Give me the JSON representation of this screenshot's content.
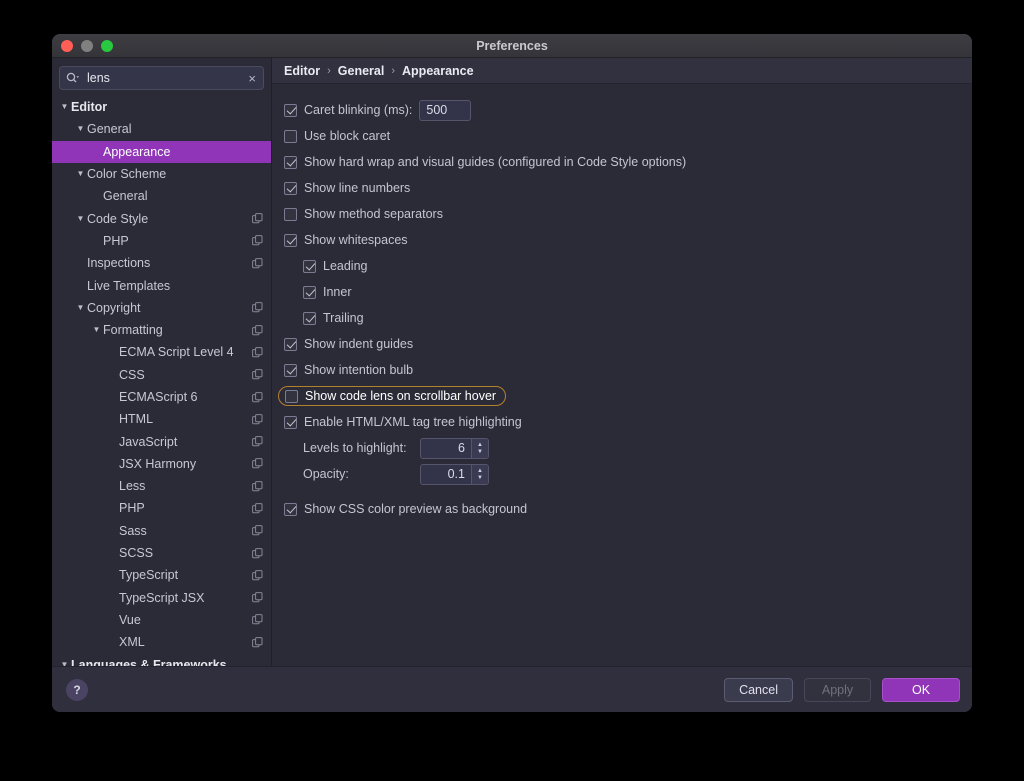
{
  "window": {
    "title": "Preferences",
    "traffic_lights": [
      "close-button",
      "minimize-button",
      "zoom-button"
    ]
  },
  "sidebar": {
    "search": {
      "value": "lens",
      "placeholder": "",
      "icon": "search-icon",
      "clear_icon": "×"
    },
    "tree": [
      {
        "label": "Editor",
        "depth": 0,
        "twisty": "▼",
        "bold": true,
        "selected": false,
        "copy": false
      },
      {
        "label": "General",
        "depth": 1,
        "twisty": "▼",
        "bold": false,
        "selected": false,
        "copy": false
      },
      {
        "label": "Appearance",
        "depth": 2,
        "twisty": "",
        "bold": false,
        "selected": true,
        "copy": false
      },
      {
        "label": "Color Scheme",
        "depth": 1,
        "twisty": "▼",
        "bold": false,
        "selected": false,
        "copy": false
      },
      {
        "label": "General",
        "depth": 2,
        "twisty": "",
        "bold": false,
        "selected": false,
        "copy": false
      },
      {
        "label": "Code Style",
        "depth": 1,
        "twisty": "▼",
        "bold": false,
        "selected": false,
        "copy": true
      },
      {
        "label": "PHP",
        "depth": 2,
        "twisty": "",
        "bold": false,
        "selected": false,
        "copy": true
      },
      {
        "label": "Inspections",
        "depth": 1,
        "twisty": "",
        "bold": false,
        "selected": false,
        "copy": true
      },
      {
        "label": "Live Templates",
        "depth": 1,
        "twisty": "",
        "bold": false,
        "selected": false,
        "copy": false
      },
      {
        "label": "Copyright",
        "depth": 1,
        "twisty": "▼",
        "bold": false,
        "selected": false,
        "copy": true
      },
      {
        "label": "Formatting",
        "depth": 2,
        "twisty": "▼",
        "bold": false,
        "selected": false,
        "copy": true
      },
      {
        "label": "ECMA Script Level 4",
        "depth": 3,
        "twisty": "",
        "bold": false,
        "selected": false,
        "copy": true
      },
      {
        "label": "CSS",
        "depth": 3,
        "twisty": "",
        "bold": false,
        "selected": false,
        "copy": true
      },
      {
        "label": "ECMAScript 6",
        "depth": 3,
        "twisty": "",
        "bold": false,
        "selected": false,
        "copy": true
      },
      {
        "label": "HTML",
        "depth": 3,
        "twisty": "",
        "bold": false,
        "selected": false,
        "copy": true
      },
      {
        "label": "JavaScript",
        "depth": 3,
        "twisty": "",
        "bold": false,
        "selected": false,
        "copy": true
      },
      {
        "label": "JSX Harmony",
        "depth": 3,
        "twisty": "",
        "bold": false,
        "selected": false,
        "copy": true
      },
      {
        "label": "Less",
        "depth": 3,
        "twisty": "",
        "bold": false,
        "selected": false,
        "copy": true
      },
      {
        "label": "PHP",
        "depth": 3,
        "twisty": "",
        "bold": false,
        "selected": false,
        "copy": true
      },
      {
        "label": "Sass",
        "depth": 3,
        "twisty": "",
        "bold": false,
        "selected": false,
        "copy": true
      },
      {
        "label": "SCSS",
        "depth": 3,
        "twisty": "",
        "bold": false,
        "selected": false,
        "copy": true
      },
      {
        "label": "TypeScript",
        "depth": 3,
        "twisty": "",
        "bold": false,
        "selected": false,
        "copy": true
      },
      {
        "label": "TypeScript JSX",
        "depth": 3,
        "twisty": "",
        "bold": false,
        "selected": false,
        "copy": true
      },
      {
        "label": "Vue",
        "depth": 3,
        "twisty": "",
        "bold": false,
        "selected": false,
        "copy": true
      },
      {
        "label": "XML",
        "depth": 3,
        "twisty": "",
        "bold": false,
        "selected": false,
        "copy": true
      },
      {
        "label": "Languages & Frameworks",
        "depth": 0,
        "twisty": "▼",
        "bold": true,
        "selected": false,
        "copy": false
      }
    ]
  },
  "breadcrumb": {
    "items": [
      "Editor",
      "General",
      "Appearance"
    ],
    "separator": "›"
  },
  "settings": {
    "caret_blinking": {
      "label": "Caret blinking (ms):",
      "checked": true,
      "value": "500"
    },
    "use_block_caret": {
      "label": "Use block caret",
      "checked": false
    },
    "show_hard_wrap": {
      "label": "Show hard wrap and visual guides (configured in Code Style options)",
      "checked": true
    },
    "show_line_numbers": {
      "label": "Show line numbers",
      "checked": true
    },
    "show_method_separators": {
      "label": "Show method separators",
      "checked": false
    },
    "show_whitespaces": {
      "label": "Show whitespaces",
      "checked": true
    },
    "whitespace_leading": {
      "label": "Leading",
      "checked": true
    },
    "whitespace_inner": {
      "label": "Inner",
      "checked": true
    },
    "whitespace_trailing": {
      "label": "Trailing",
      "checked": true
    },
    "show_indent_guides": {
      "label": "Show indent guides",
      "checked": true
    },
    "show_intention_bulb": {
      "label": "Show intention bulb",
      "checked": true
    },
    "show_code_lens": {
      "label": "Show code lens on scrollbar hover",
      "checked": false,
      "highlighted": true,
      "highlight_color": "#b5802e"
    },
    "enable_tag_tree": {
      "label": "Enable HTML/XML tag tree highlighting",
      "checked": true
    },
    "levels_to_highlight": {
      "label": "Levels to highlight:",
      "value": "6"
    },
    "opacity": {
      "label": "Opacity:",
      "value": "0.1"
    },
    "show_css_preview": {
      "label": "Show CSS color preview as background",
      "checked": true
    }
  },
  "footer": {
    "help_label": "?",
    "cancel_label": "Cancel",
    "apply_label": "Apply",
    "ok_label": "OK",
    "accent_color": "#9035b8"
  }
}
